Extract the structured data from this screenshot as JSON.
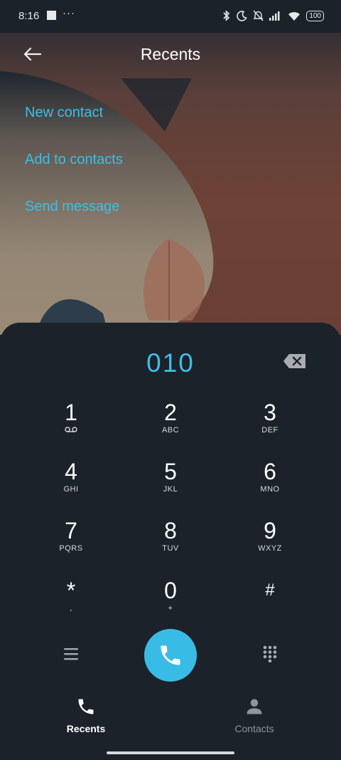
{
  "status": {
    "time": "8:16",
    "more": "···",
    "battery": "100"
  },
  "header": {
    "title": "Recents",
    "back_icon": "arrow-left-icon"
  },
  "menu": [
    {
      "label": "New contact"
    },
    {
      "label": "Add to contacts"
    },
    {
      "label": "Send message"
    }
  ],
  "dialer": {
    "number": "010",
    "keys": [
      {
        "digit": "1",
        "sub": ""
      },
      {
        "digit": "2",
        "sub": "ABC"
      },
      {
        "digit": "3",
        "sub": "DEF"
      },
      {
        "digit": "4",
        "sub": "GHI"
      },
      {
        "digit": "5",
        "sub": "JKL"
      },
      {
        "digit": "6",
        "sub": "MNO"
      },
      {
        "digit": "7",
        "sub": "PQRS"
      },
      {
        "digit": "8",
        "sub": "TUV"
      },
      {
        "digit": "9",
        "sub": "WXYZ"
      },
      {
        "digit": "*",
        "sub": ","
      },
      {
        "digit": "0",
        "sub": "+"
      },
      {
        "digit": "#",
        "sub": ""
      }
    ]
  },
  "tabs": [
    {
      "label": "Recents",
      "active": true
    },
    {
      "label": "Contacts",
      "active": false
    }
  ],
  "colors": {
    "accent": "#3bbfe7",
    "panel": "#1b222a"
  }
}
